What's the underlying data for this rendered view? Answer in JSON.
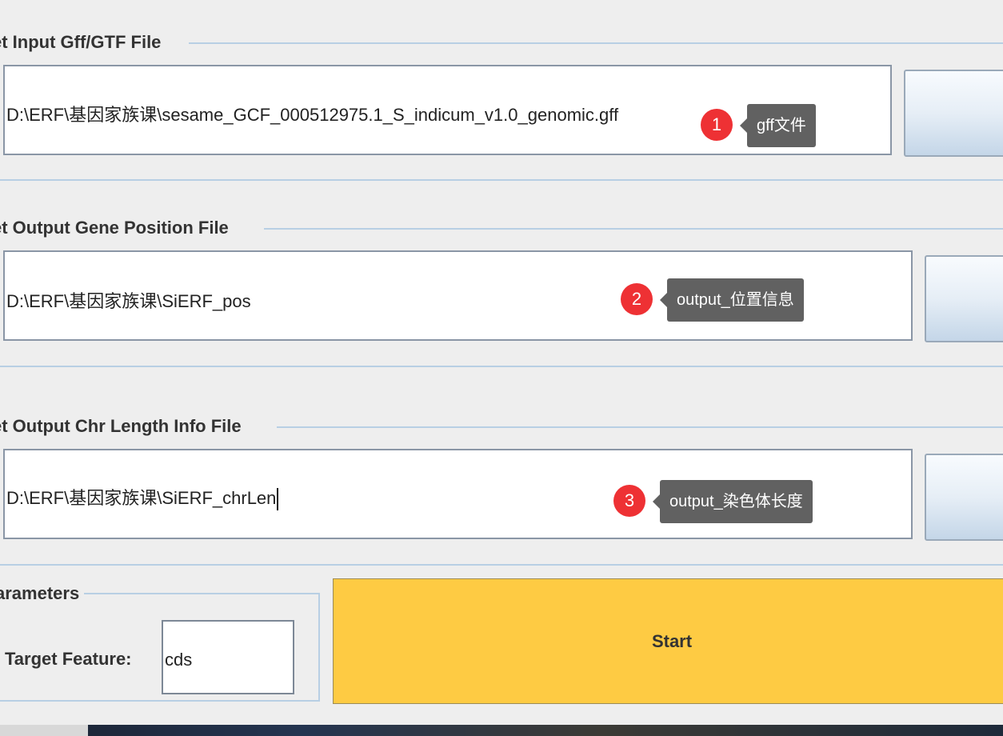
{
  "sections": {
    "input": {
      "title": "et Input Gff/GTF File",
      "value": "D:\\ERF\\基因家族课\\sesame_GCF_000512975.1_S_indicum_v1.0_genomic.gff",
      "marker": "1",
      "tooltip": "gff文件"
    },
    "position": {
      "title": "et Output Gene Position File",
      "value": "D:\\ERF\\基因家族课\\SiERF_pos",
      "marker": "2",
      "tooltip": "output_位置信息"
    },
    "chrlen": {
      "title": "et Output Chr Length Info File",
      "value": "D:\\ERF\\基因家族课\\SiERF_chrLen",
      "marker": "3",
      "tooltip": "output_染色体长度"
    }
  },
  "parameters": {
    "title": "arameters",
    "target_feature_label": "Target Feature:",
    "target_feature_value": "cds"
  },
  "start_label": "Start",
  "colors": {
    "marker": "#ee3134",
    "tooltip": "#616161",
    "start_button": "#fecb43",
    "border_line": "#b8cfe4"
  }
}
